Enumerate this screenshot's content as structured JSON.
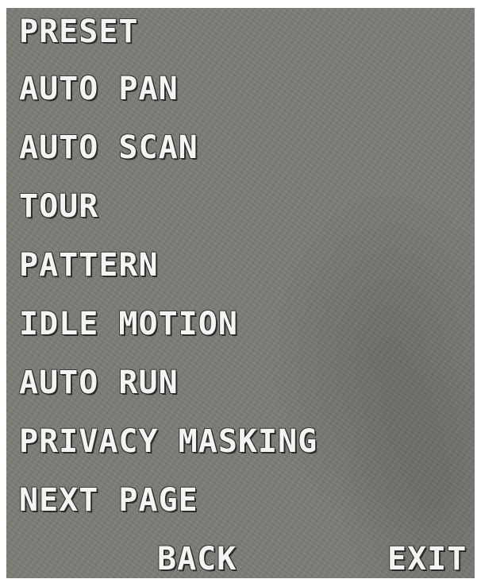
{
  "menu": {
    "items": [
      {
        "label": "PRESET"
      },
      {
        "label": "AUTO PAN"
      },
      {
        "label": "AUTO SCAN"
      },
      {
        "label": "TOUR"
      },
      {
        "label": "PATTERN"
      },
      {
        "label": "IDLE MOTION"
      },
      {
        "label": "AUTO RUN"
      },
      {
        "label": "PRIVACY MASKING"
      },
      {
        "label": "NEXT PAGE"
      }
    ],
    "back_label": "BACK",
    "exit_label": "EXIT"
  },
  "colors": {
    "text": "#f4f4f2",
    "background": "#7d7d78",
    "text_outline": "#2b2b2b"
  }
}
